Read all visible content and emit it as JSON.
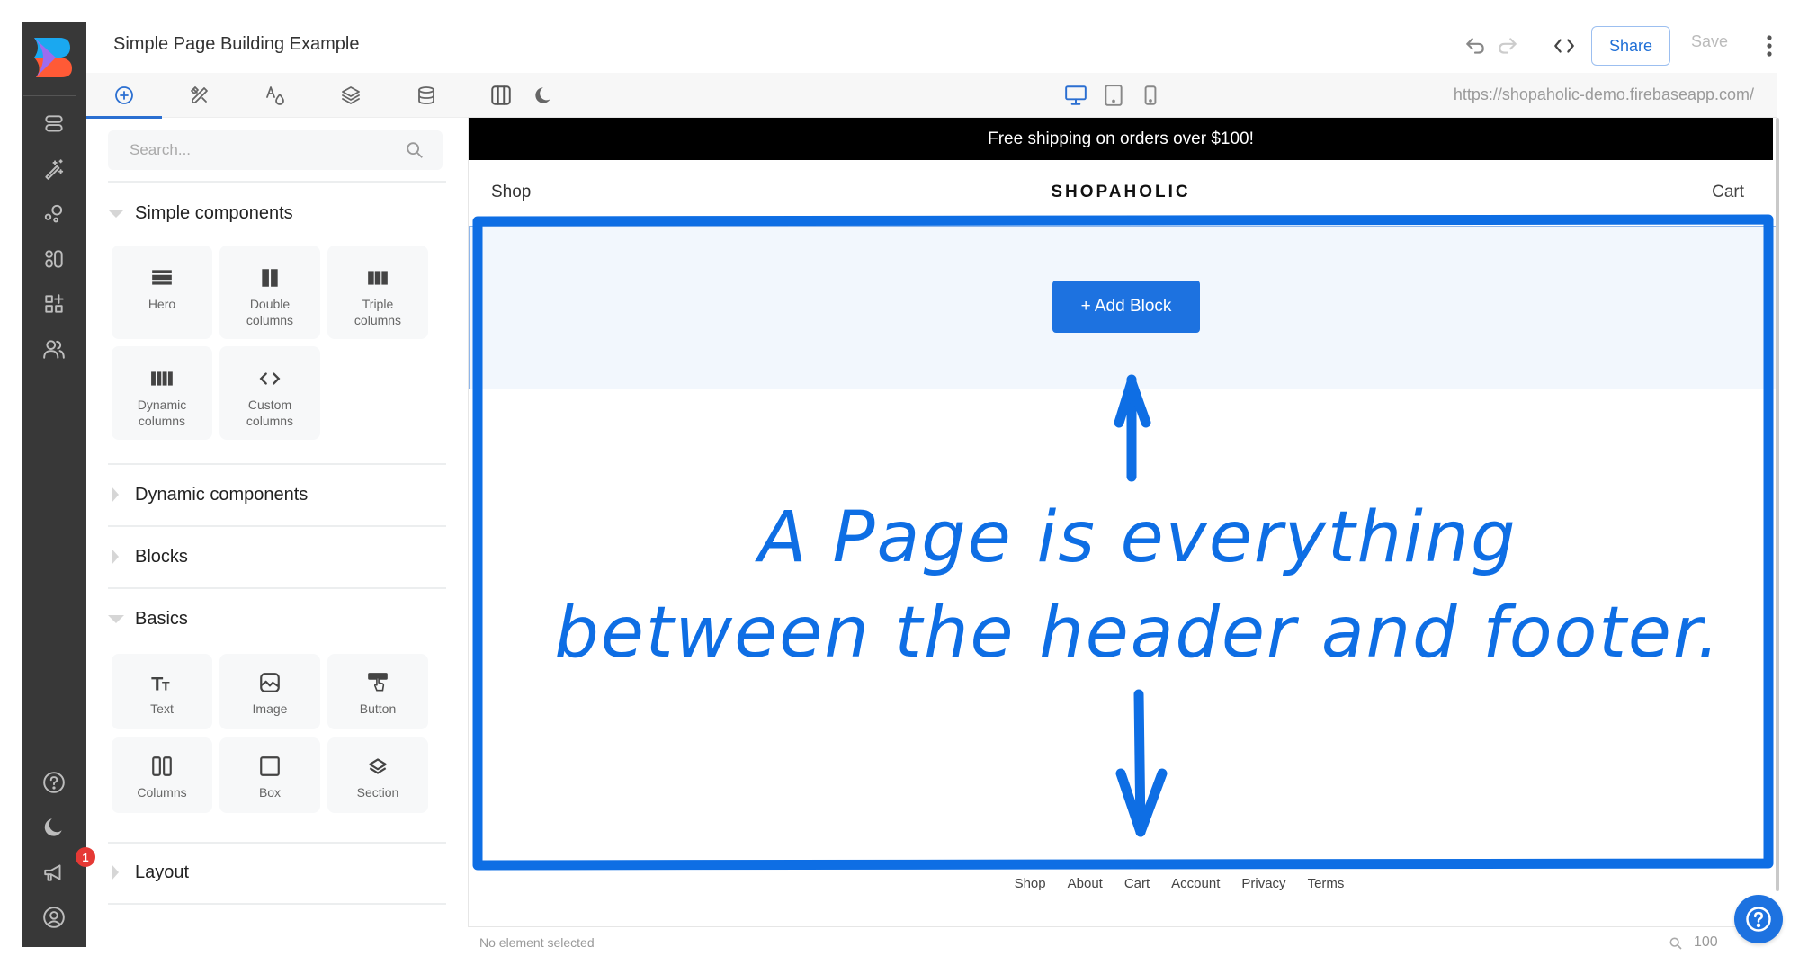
{
  "app": {
    "title": "Simple Page Building Example",
    "logo": "builder-logo",
    "colors": {
      "accent": "#1d72e0",
      "sidebar_bg": "#383838",
      "annotation": "#0e6ee4",
      "badge": "#e53935",
      "logo_blue": "#1aa8f0",
      "logo_purple": "#9b6cf0",
      "logo_orange": "#ff5a36"
    }
  },
  "sidebar": {
    "top_items": [
      {
        "icon": "pages-icon"
      },
      {
        "icon": "magic-wand-icon"
      },
      {
        "icon": "components-icon"
      },
      {
        "icon": "layout-icon"
      },
      {
        "icon": "apps-add-icon"
      },
      {
        "icon": "users-icon"
      }
    ],
    "bottom_items": [
      {
        "icon": "help-icon"
      },
      {
        "icon": "dark-mode-icon"
      },
      {
        "icon": "announcements-icon",
        "badge": "1"
      },
      {
        "icon": "account-icon"
      }
    ]
  },
  "toolbar": {
    "undo": "undo-icon",
    "redo": "redo-icon",
    "code": "code-icon",
    "share_label": "Share",
    "save_label": "Save",
    "more": "more-vertical-icon"
  },
  "panel": {
    "tabs": [
      {
        "icon": "add-circle-icon",
        "active": true
      },
      {
        "icon": "design-tools-icon",
        "active": false
      },
      {
        "icon": "typography-color-icon",
        "active": false
      },
      {
        "icon": "layers-icon",
        "active": false
      },
      {
        "icon": "database-icon",
        "active": false
      }
    ],
    "search": {
      "placeholder": "Search...",
      "value": ""
    },
    "sections": [
      {
        "label": "Simple components",
        "expanded": true,
        "items": [
          {
            "label": "Hero",
            "icon": "hero-icon"
          },
          {
            "label": "Double columns",
            "icon": "double-columns-icon"
          },
          {
            "label": "Triple columns",
            "icon": "triple-columns-icon"
          },
          {
            "label": "Dynamic columns",
            "icon": "dynamic-columns-icon"
          },
          {
            "label": "Custom columns",
            "icon": "code-icon"
          }
        ]
      },
      {
        "label": "Dynamic components",
        "expanded": false
      },
      {
        "label": "Blocks",
        "expanded": false
      },
      {
        "label": "Basics",
        "expanded": true,
        "items": [
          {
            "label": "Text",
            "icon": "text-icon"
          },
          {
            "label": "Image",
            "icon": "image-icon"
          },
          {
            "label": "Button",
            "icon": "button-icon"
          },
          {
            "label": "Columns",
            "icon": "columns-icon"
          },
          {
            "label": "Box",
            "icon": "box-icon"
          },
          {
            "label": "Section",
            "icon": "section-icon"
          }
        ]
      },
      {
        "label": "Layout",
        "expanded": false
      }
    ]
  },
  "canvas_toolbar": {
    "left": [
      "panels-icon",
      "dark-mode-icon"
    ],
    "devices": [
      {
        "icon": "desktop-icon",
        "active": true
      },
      {
        "icon": "tablet-icon",
        "active": false
      },
      {
        "icon": "mobile-icon",
        "active": false
      }
    ],
    "url": "https://shopaholic-demo.firebaseapp.com/"
  },
  "site": {
    "promo": "Free shipping on orders over $100!",
    "header": {
      "left_link": "Shop",
      "brand": "SHOPAHOLIC",
      "right_link": "Cart"
    },
    "add_block_label": "+ Add Block",
    "footer_links": [
      "Shop",
      "About",
      "Cart",
      "Account",
      "Privacy",
      "Terms"
    ]
  },
  "statusbar": {
    "text": "No element selected",
    "zoom": "100"
  },
  "annotation": {
    "line1": "A Page is everything",
    "line2": "between the header and footer."
  }
}
